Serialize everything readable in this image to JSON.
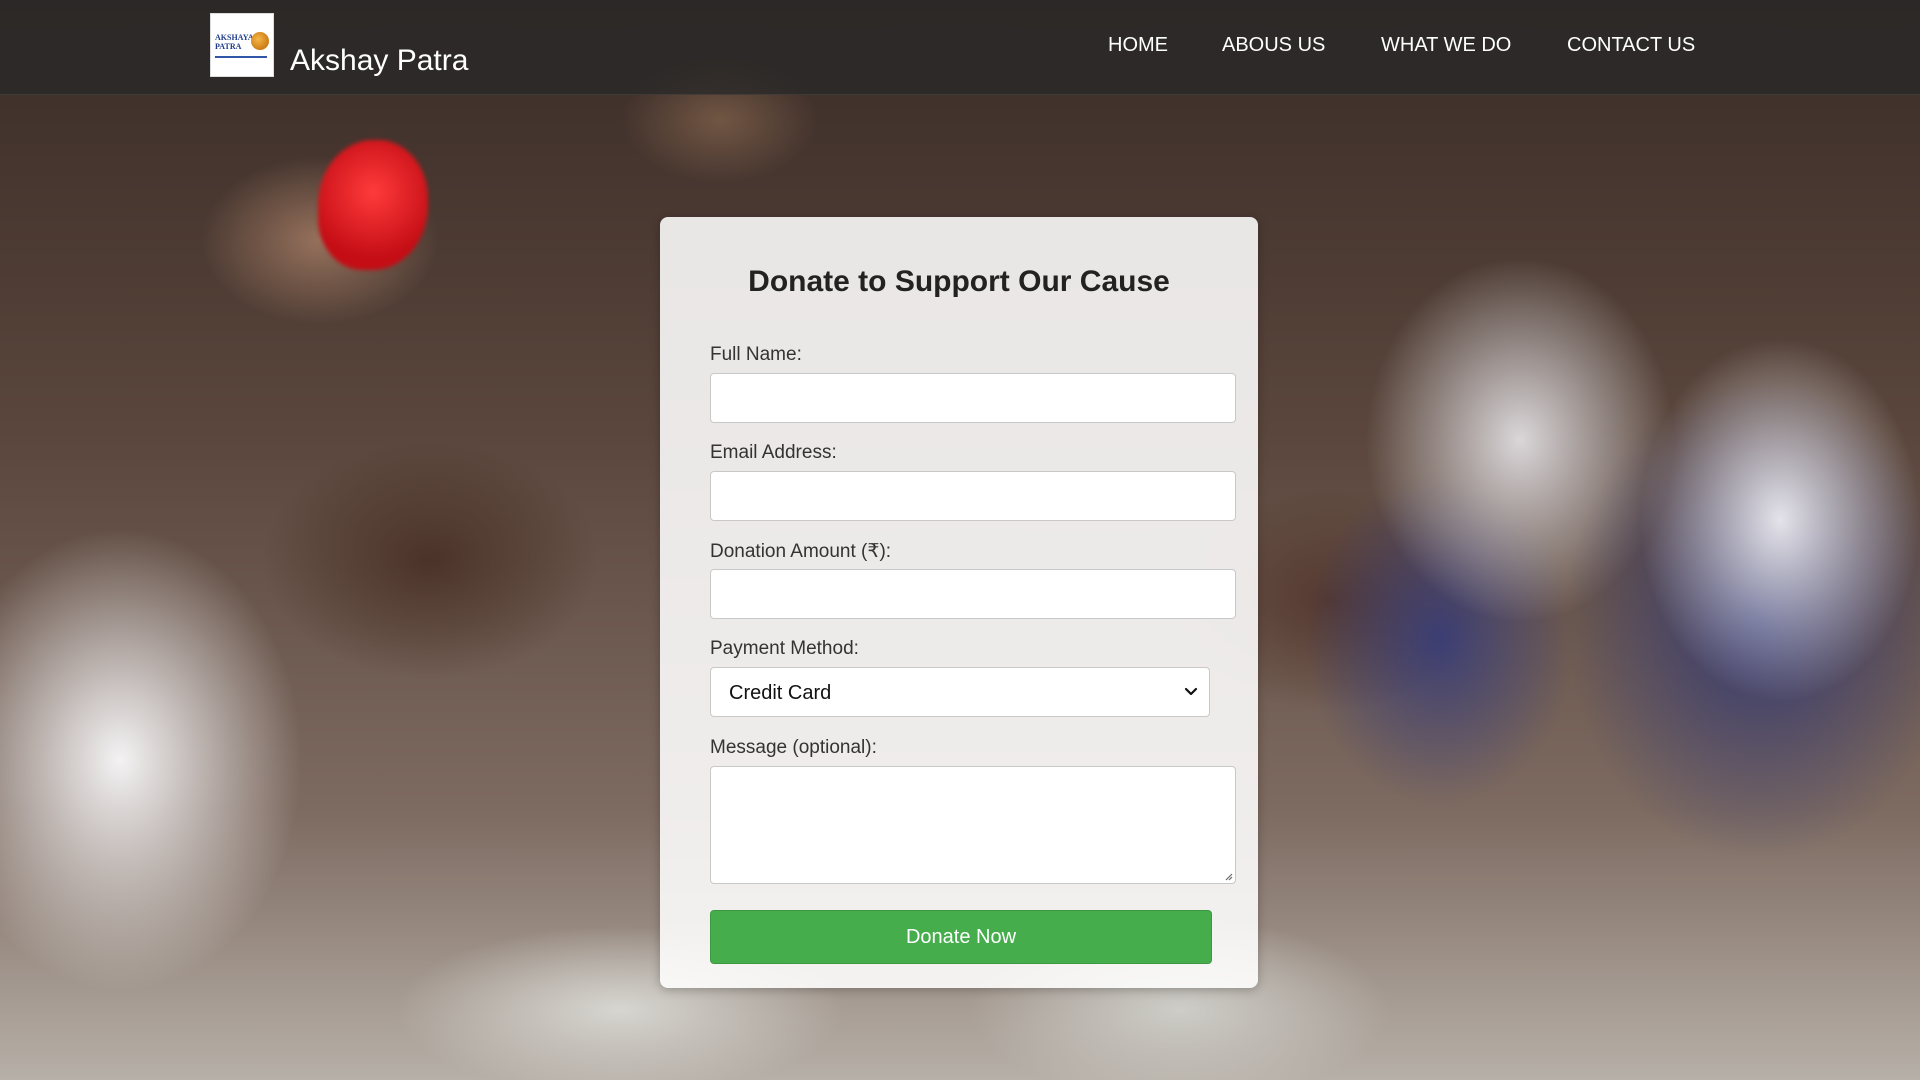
{
  "header": {
    "logo_text": "AKSHAYA PATRA",
    "brand": "Akshay Patra",
    "nav": [
      {
        "label": "HOME"
      },
      {
        "label": "ABOUS US"
      },
      {
        "label": "WHAT WE DO"
      },
      {
        "label": "CONTACT US"
      }
    ]
  },
  "form": {
    "title": "Donate to Support Our Cause",
    "full_name": {
      "label": "Full Name:",
      "value": ""
    },
    "email": {
      "label": "Email Address:",
      "value": ""
    },
    "amount": {
      "label": "Donation Amount (₹):",
      "value": ""
    },
    "payment": {
      "label": "Payment Method:",
      "selected": "Credit Card"
    },
    "message": {
      "label": "Message (optional):",
      "value": ""
    },
    "submit_label": "Donate Now"
  },
  "colors": {
    "navbar": "#282828",
    "button": "#46ad4c",
    "form_panel": "#ffffff"
  }
}
